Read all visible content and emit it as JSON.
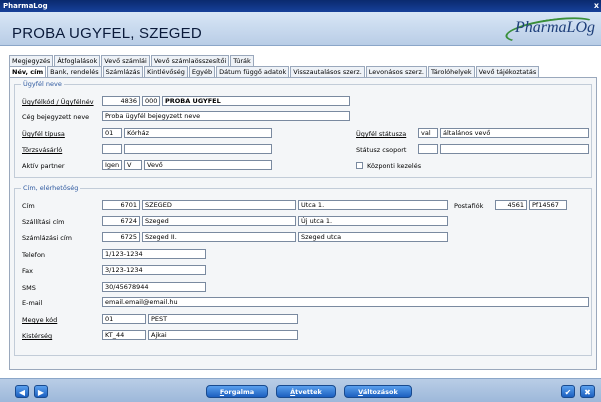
{
  "window": {
    "title": "PharmaLog",
    "close_glyph": "x"
  },
  "header": {
    "client_name": "PROBA UGYFEL, SZEGED",
    "logo_text": "PharmaL",
    "logo_o": "O",
    "logo_end": "g"
  },
  "tabs_top": [
    "Megjegyzés",
    "Átfoglalások",
    "Vevő számlái",
    "Vevő számlaösszesítői",
    "Túrák"
  ],
  "tabs_bottom": [
    "Név, cím",
    "Bank, rendelés",
    "Számlázás",
    "Kintlévőség",
    "Egyéb",
    "Dátum függő adatok",
    "Visszautalásos szerz.",
    "Levonásos szerz.",
    "Tárolóhelyek",
    "Vevő tájékoztatás"
  ],
  "section_name": {
    "legend": "Ügyfél neve",
    "id_label": "Ügyfélkód / Ügyfélnév",
    "id_code": "4836",
    "id_sub": "000",
    "id_name": "PROBA UGYFEL",
    "reg_label": "Cég bejegyzett neve",
    "reg_value": "Proba ügyfél bejegyzett neve",
    "type_label": "Ügyfél típusa",
    "type_code": "01",
    "type_name": "Kórház",
    "regular_label": "Törzsvásárló",
    "regular_code": "",
    "regular_name": "",
    "active_label": "Aktív partner",
    "active_value": "Igen",
    "active_code": "V",
    "active_name": "Vevő",
    "status_label": "Ügyfél státusza",
    "status_code": "val",
    "status_name": "általános vevő",
    "group_label": "Státusz csoport",
    "group_code": "",
    "group_name": "",
    "central_label": "Központi kezelés"
  },
  "section_address": {
    "legend": "Cím, elérhetőség",
    "addr_label": "Cím",
    "addr_zip": "6701",
    "addr_city": "SZEGED",
    "addr_street": "Utca 1.",
    "pobox_label": "Postafiók",
    "pobox_zip": "4561",
    "pobox_value": "Pf14567",
    "ship_label": "Szállítási cím",
    "ship_zip": "6724",
    "ship_city": "Szeged",
    "ship_street": "Új utca 1.",
    "bill_label": "Számlázási cím",
    "bill_zip": "6725",
    "bill_city": "Szeged II.",
    "bill_street": "Szeged utca",
    "phone_label": "Telefon",
    "phone": "1/123-1234",
    "fax_label": "Fax",
    "fax": "3/123-1234",
    "sms_label": "SMS",
    "sms": "30/45678944",
    "email_label": "E-mail",
    "email": "email.email@email.hu",
    "county_label": "Megye kód",
    "county_code": "01",
    "county_name": "PEST",
    "region_label": "Kistérség",
    "region_code": "KT_44",
    "region_name": "Ajkai"
  },
  "footer": {
    "turnover_acc": "F",
    "turnover_rest": "orgalma",
    "received_acc": "Á",
    "received_rest": "tvettek",
    "changes_acc": "V",
    "changes_rest": "áltozások",
    "prev_glyph": "◀",
    "next_glyph": "▶",
    "ok_glyph": "✔",
    "cancel_glyph": "✖"
  },
  "colors": {
    "accent": "#1c5fbf",
    "legend": "#2f5aa0",
    "header_bg": "#c8daef"
  }
}
